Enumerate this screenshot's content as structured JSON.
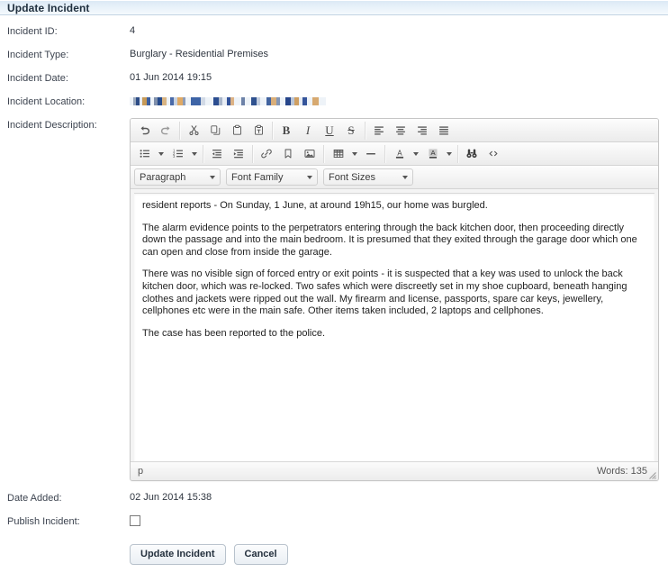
{
  "header": {
    "title": "Update Incident"
  },
  "fields": [
    {
      "label": "Incident ID:",
      "value": "4"
    },
    {
      "label": "Incident Type:",
      "value": "Burglary - Residential Premises"
    },
    {
      "label": "Incident Date:",
      "value": "01 Jun 2014 19:15"
    },
    {
      "label": "Incident Location:",
      "value": ""
    }
  ],
  "description": {
    "label": "Incident Description:",
    "toolbar": {
      "row1": [
        {
          "name": "undo-icon",
          "title": "Undo"
        },
        {
          "name": "redo-icon",
          "title": "Redo"
        },
        {
          "name": "cut-icon",
          "title": "Cut"
        },
        {
          "name": "copy-icon",
          "title": "Copy"
        },
        {
          "name": "paste-icon",
          "title": "Paste"
        },
        {
          "name": "paste-as-text-icon",
          "title": "Paste as text"
        },
        {
          "name": "bold-icon",
          "title": "Bold",
          "glyph": "B"
        },
        {
          "name": "italic-icon",
          "title": "Italic",
          "glyph": "I"
        },
        {
          "name": "underline-icon",
          "title": "Underline",
          "glyph": "U"
        },
        {
          "name": "strikethrough-icon",
          "title": "Strikethrough",
          "glyph": "S"
        },
        {
          "name": "align-left-icon",
          "title": "Align left"
        },
        {
          "name": "align-center-icon",
          "title": "Align center"
        },
        {
          "name": "align-right-icon",
          "title": "Align right"
        },
        {
          "name": "align-justify-icon",
          "title": "Justify"
        }
      ],
      "row2": [
        {
          "name": "bullet-list-icon",
          "title": "Bullet list"
        },
        {
          "name": "numbered-list-icon",
          "title": "Numbered list"
        },
        {
          "name": "outdent-icon",
          "title": "Decrease indent"
        },
        {
          "name": "indent-icon",
          "title": "Increase indent"
        },
        {
          "name": "link-icon",
          "title": "Insert/edit link"
        },
        {
          "name": "anchor-icon",
          "title": "Anchor"
        },
        {
          "name": "image-icon",
          "title": "Insert/edit image"
        },
        {
          "name": "table-icon",
          "title": "Table"
        },
        {
          "name": "horizontal-rule-icon",
          "title": "Horizontal line"
        },
        {
          "name": "text-color-icon",
          "title": "Text color"
        },
        {
          "name": "background-color-icon",
          "title": "Background color"
        },
        {
          "name": "find-replace-icon",
          "title": "Find and replace"
        },
        {
          "name": "source-code-icon",
          "title": "Source code"
        }
      ],
      "selects": [
        {
          "name": "paragraph-select",
          "label": "Paragraph"
        },
        {
          "name": "font-family-select",
          "label": "Font Family"
        },
        {
          "name": "font-sizes-select",
          "label": "Font Sizes"
        }
      ]
    },
    "body_paragraphs": [
      "resident reports - On Sunday, 1 June, at around 19h15, our home was burgled.",
      "The alarm evidence points to the perpetrators entering through the back kitchen door, then proceeding directly down the passage and into the main bedroom. It is presumed that they exited through the garage door which one can open and close from inside the garage.",
      "There was no visible sign of forced entry or exit points - it is suspected that a key was used to unlock the back kitchen door, which was re-locked. Two safes which were discreetly set in my shoe cupboard, beneath hanging clothes and jackets were ripped out the wall. My firearm and license, passports, spare car keys, jewellery, cellphones etc were in the main safe. Other items taken included, 2 laptops and cellphones.",
      "The case has been reported to the police."
    ],
    "status": {
      "element_path": "p",
      "word_count": "Words: 135"
    }
  },
  "date_added": {
    "label": "Date Added:",
    "value": "02 Jun 2014 15:38"
  },
  "publish": {
    "label": "Publish Incident:",
    "checked": false
  },
  "actions": {
    "submit_label": "Update Incident",
    "cancel_label": "Cancel"
  },
  "colors": {
    "header_bg": "#dce9f5",
    "header_text": "#20303f",
    "label_text": "#3d4450",
    "value_text": "#2f3640",
    "toolbar_bg": "#ebebeb",
    "editor_border": "#c6c6c6",
    "button_border": "#b8c2cc"
  }
}
